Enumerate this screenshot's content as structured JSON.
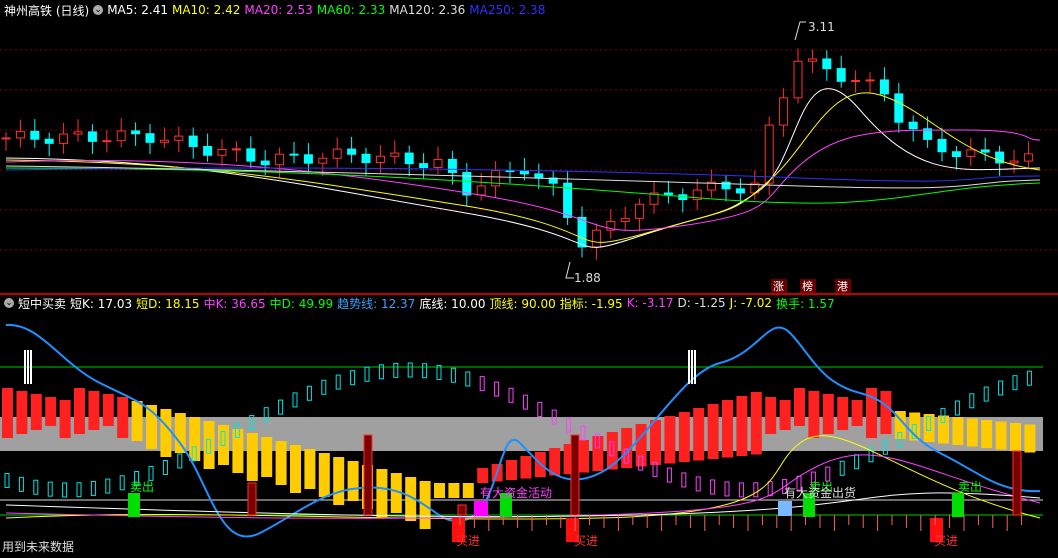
{
  "main": {
    "title": "神州高铁 (日线)",
    "ma": [
      {
        "label": "MA5: 2.41",
        "color": "#ffffff"
      },
      {
        "label": "MA10: 2.42",
        "color": "#ffff00"
      },
      {
        "label": "MA20: 2.53",
        "color": "#ff40ff"
      },
      {
        "label": "MA60: 2.33",
        "color": "#00ff00"
      },
      {
        "label": "MA120: 2.36",
        "color": "#dddddd"
      },
      {
        "label": "MA250: 2.38",
        "color": "#3030ff"
      }
    ],
    "high_label": "3.11",
    "low_label": "1.88",
    "tags": [
      "涨",
      "榜",
      "港"
    ]
  },
  "indicator": {
    "title": "短中买卖",
    "values": [
      {
        "label": "短K: 17.03",
        "color": "#ffffff"
      },
      {
        "label": "短D: 18.15",
        "color": "#ffff00"
      },
      {
        "label": "中K: 36.65",
        "color": "#ff40ff"
      },
      {
        "label": "中D: 49.99",
        "color": "#00ff00"
      },
      {
        "label": "趋势线: 12.37",
        "color": "#3aa0ff"
      },
      {
        "label": "底线: 10.00",
        "color": "#ffffff"
      },
      {
        "label": "顶线: 90.00",
        "color": "#ffff00"
      },
      {
        "label": "指标: -1.95",
        "color": "#ffff00"
      },
      {
        "label": "K: -3.17",
        "color": "#ff40ff"
      },
      {
        "label": "D: -1.25",
        "color": "#dddddd"
      },
      {
        "label": "J: -7.02",
        "color": "#ffff00"
      },
      {
        "label": "换手: 1.57",
        "color": "#00ff00"
      }
    ],
    "signals": {
      "sell": "卖出",
      "buy": "买进",
      "inflow": "有大资金活动",
      "outflow": "有大资金出货"
    }
  },
  "footer": {
    "future_data": "用到未来数据"
  },
  "colors": {
    "up": "#ff3030",
    "down": "#00ffff",
    "grid": "#800000",
    "band": "#a0a0a0"
  }
}
